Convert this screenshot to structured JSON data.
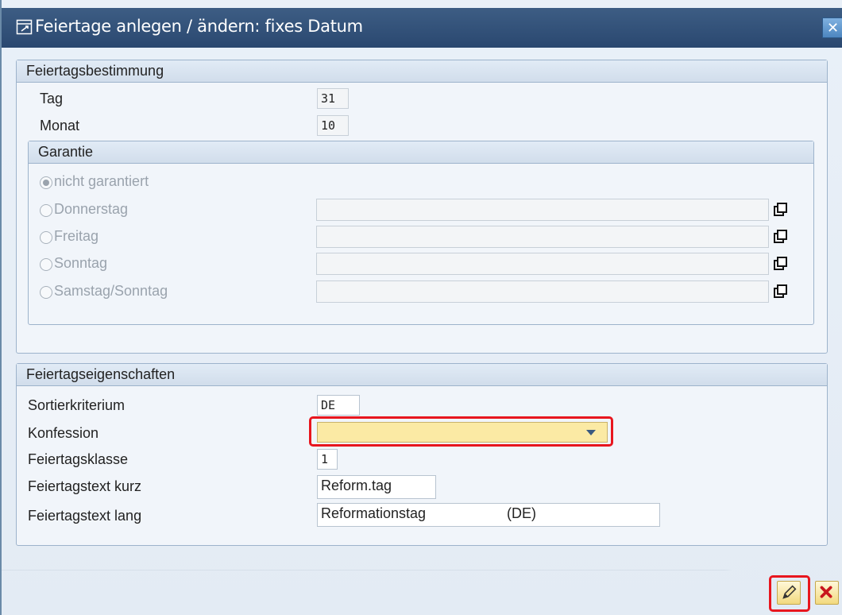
{
  "window": {
    "title": "Feiertage anlegen / ändern: fixes Datum"
  },
  "section_bestimmung": {
    "header": "Feiertagsbestimmung",
    "tag_label": "Tag",
    "tag_value": "31",
    "monat_label": "Monat",
    "monat_value": "10",
    "garantie": {
      "header": "Garantie",
      "options": [
        {
          "label": "nicht garantiert",
          "selected": true
        },
        {
          "label": "Donnerstag",
          "selected": false
        },
        {
          "label": "Freitag",
          "selected": false
        },
        {
          "label": "Sonntag",
          "selected": false
        },
        {
          "label": "Samstag/Sonntag",
          "selected": false
        }
      ]
    }
  },
  "section_eigenschaften": {
    "header": "Feiertagseigenschaften",
    "sortierkriterium_label": "Sortierkriterium",
    "sortierkriterium_value": "DE",
    "konfession_label": "Konfession",
    "konfession_value": "",
    "feiertagsklasse_label": "Feiertagsklasse",
    "feiertagsklasse_value": "1",
    "text_kurz_label": "Feiertagstext kurz",
    "text_kurz_value": "Reform.tag",
    "text_lang_label": "Feiertagstext lang",
    "text_lang_value": "Reformationstag",
    "text_lang_suffix": "(DE)"
  },
  "colors": {
    "titlebar": "#2f4f78",
    "highlight": "#e8161e",
    "required_field": "#fbeaa4"
  },
  "icons": {
    "title": "edit-window-icon",
    "close": "close-icon",
    "copy": "copy-icon",
    "edit_button": "pencil-icon",
    "cancel_button": "cancel-x-icon"
  }
}
